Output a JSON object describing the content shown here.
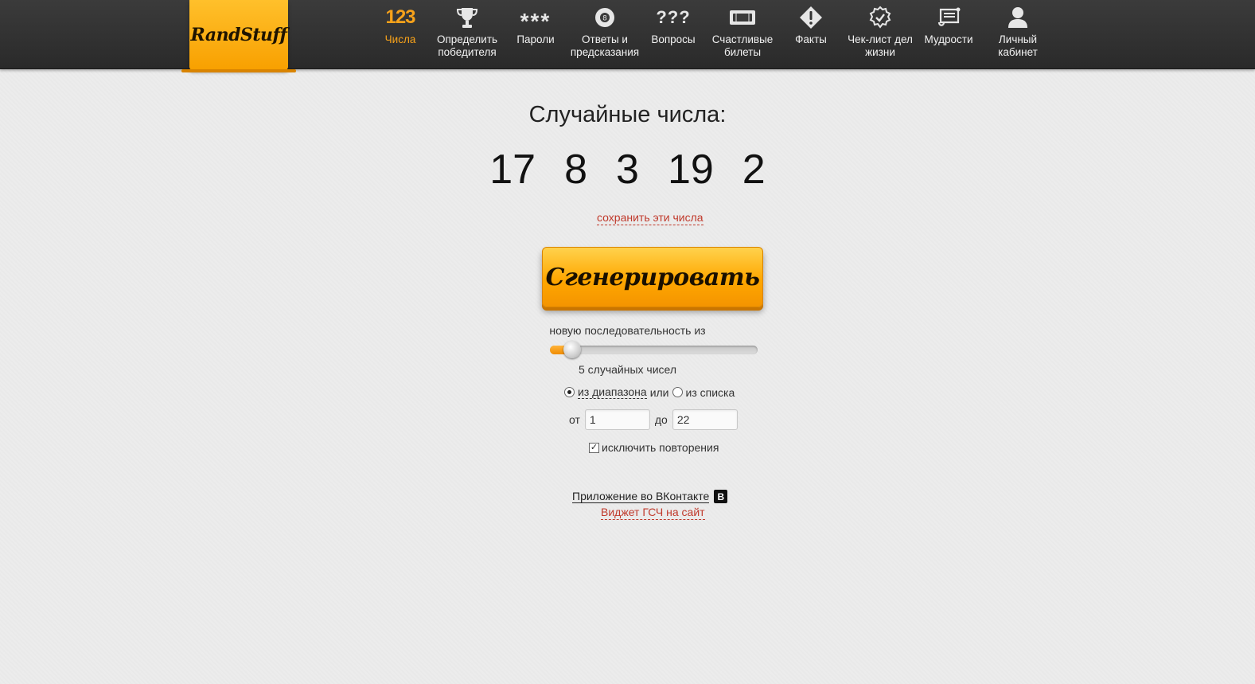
{
  "brand": {
    "logo_text": "RandStuff",
    "accent": "#f7a21a"
  },
  "nav": {
    "items": [
      {
        "label": "Числа",
        "icon": "123",
        "icon_name": "numbers-icon",
        "active": true
      },
      {
        "label": "Определить победителя",
        "icon_name": "trophy-icon"
      },
      {
        "label": "Пароли",
        "icon": "***",
        "icon_name": "password-icon"
      },
      {
        "label": "Ответы и предсказания",
        "icon_name": "magic-8-ball-icon"
      },
      {
        "label": "Вопросы",
        "icon": "???",
        "icon_name": "questions-icon"
      },
      {
        "label": "Счастливые билеты",
        "icon_name": "ticket-icon"
      },
      {
        "label": "Факты",
        "icon_name": "exclamation-icon"
      },
      {
        "label": "Чек-лист дел жизни",
        "icon_name": "checkmark-badge-icon"
      },
      {
        "label": "Мудрости",
        "icon_name": "scroll-icon"
      },
      {
        "label": "Личный кабинет",
        "icon_name": "user-icon"
      }
    ]
  },
  "main": {
    "title": "Случайные числа:",
    "numbers": [
      "17",
      "8",
      "3",
      "19",
      "2"
    ],
    "save_link": "сохранить эти числа",
    "generate_button": "Сгенерировать",
    "sequence_label": "новую последовательность из",
    "slider": {
      "value": 5,
      "min": 1,
      "max": 100
    },
    "count_label": "5 случайных чисел",
    "radio_range": "из диапазона",
    "radio_or": "или",
    "radio_list": "из списка",
    "from_label": "от",
    "from_value": "1",
    "to_label": "до",
    "to_value": "22",
    "exclude_repeats": "исключить повторения",
    "vk_app_link": "Приложение во ВКонтакте",
    "vk_badge": "B",
    "widget_link": "Виджет ГСЧ на сайт"
  }
}
